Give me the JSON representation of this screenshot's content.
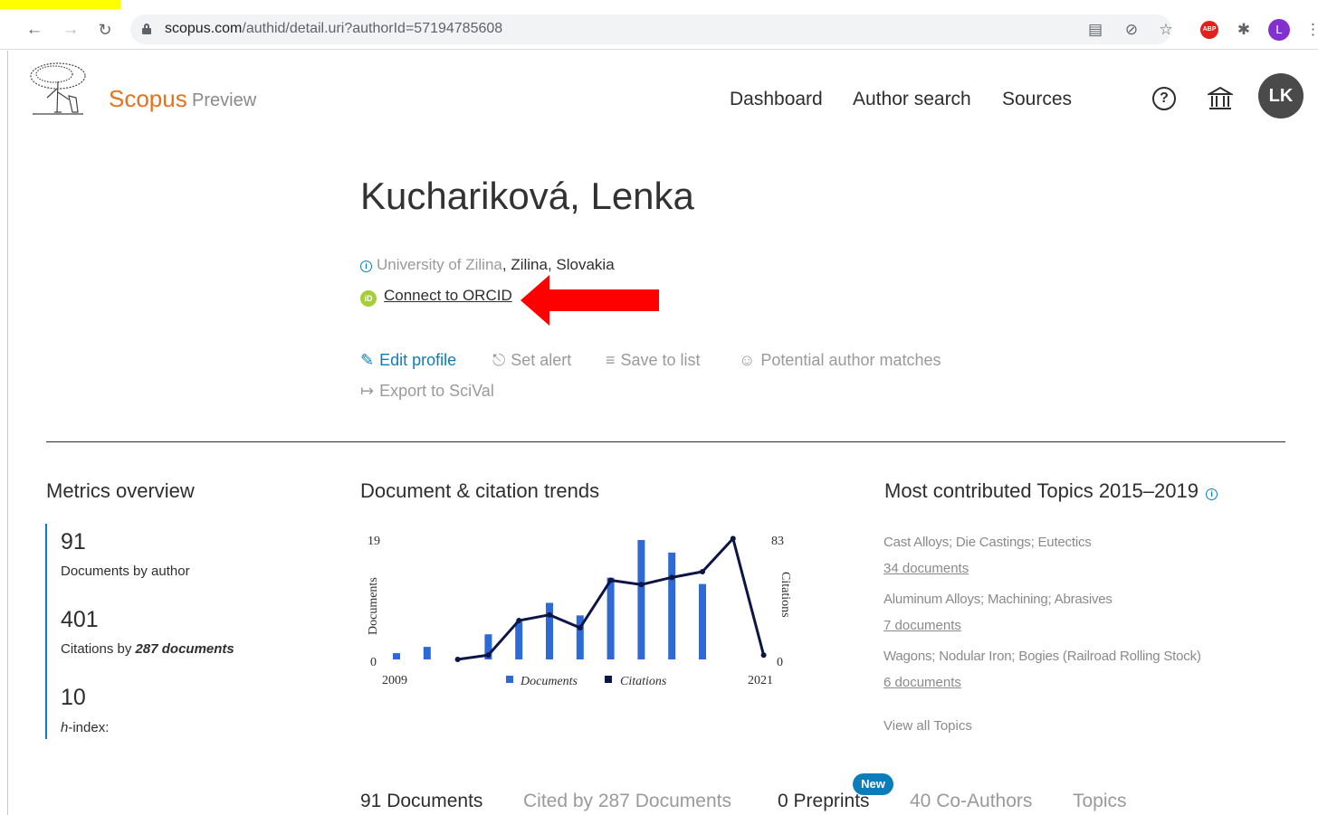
{
  "browser": {
    "url_domain": "scopus.com",
    "url_path": "/authid/detail.uri?authorId=57194785608",
    "profile_initial": "L",
    "abp_label": "ABP"
  },
  "header": {
    "brand": "Scopus",
    "brand_sub": "Preview",
    "nav": [
      "Dashboard",
      "Author search",
      "Sources"
    ],
    "help_glyph": "?",
    "avatar_initials": "LK"
  },
  "author": {
    "name": "Kuchariková, Lenka",
    "institution": "University of Zilina",
    "location": ", Zilina, Slovakia",
    "orcid_link": "Connect to ORCID",
    "orcid_badge": "iD",
    "info_glyph": "i"
  },
  "actions": {
    "edit_profile": "Edit profile",
    "set_alert": "Set alert",
    "save_to_list": "Save to list",
    "potential_matches": "Potential author matches",
    "export_scival": "Export to SciVal"
  },
  "metrics": {
    "title": "Metrics overview",
    "documents_value": "91",
    "documents_label": "Documents by author",
    "citations_value": "401",
    "citations_label_prefix": "Citations by ",
    "citations_label_bold": "287 documents",
    "hindex_value": "10",
    "hindex_label_italic": "h",
    "hindex_label_rest": "-index:"
  },
  "trends": {
    "title": "Document & citation trends"
  },
  "chart_data": {
    "type": "bar",
    "x_start_label": "2009",
    "x_end_label": "2021",
    "ylabel": "Documents",
    "y2label": "Citations",
    "ylim": [
      0,
      19
    ],
    "y2lim": [
      0,
      83
    ],
    "y_top_label": "19",
    "y_bottom_label": "0",
    "y2_top_label": "83",
    "y2_bottom_label": "0",
    "years": [
      2009,
      2010,
      2011,
      2012,
      2013,
      2014,
      2015,
      2016,
      2017,
      2018,
      2019,
      2020,
      2021
    ],
    "series": [
      {
        "name": "Documents",
        "type": "bar",
        "values": [
          1,
          2,
          0,
          4,
          6,
          9,
          7,
          13,
          19,
          17,
          12,
          0,
          0
        ]
      },
      {
        "name": "Citations",
        "type": "line",
        "values": [
          null,
          null,
          0,
          3,
          27,
          31,
          22,
          55,
          52,
          57,
          61,
          84,
          3
        ]
      }
    ],
    "colors": {
      "documents": "#2e6ad6",
      "citations": "#0c1546"
    }
  },
  "topics": {
    "title": "Most contributed Topics 2015–2019",
    "info_glyph": "i",
    "items": [
      {
        "name": "Cast Alloys; Die Castings; Eutectics",
        "docs": "34 documents"
      },
      {
        "name": "Aluminum Alloys; Machining; Abrasives",
        "docs": "7 documents"
      },
      {
        "name": "Wagons; Nodular Iron; Bogies (Railroad Rolling Stock)",
        "docs": "6 documents"
      }
    ],
    "view_all": "View all Topics"
  },
  "bottom_tabs": {
    "documents": "91 Documents",
    "cited_by": "Cited by 287 Documents",
    "preprints": "0 Preprints",
    "new_badge": "New",
    "coauthors": "40 Co-Authors",
    "topics": "Topics"
  },
  "colors": {
    "accent": "#0c7dbb",
    "brand": "#e9711c",
    "arrow": "#ff0000",
    "orcid": "#a6ce39"
  }
}
